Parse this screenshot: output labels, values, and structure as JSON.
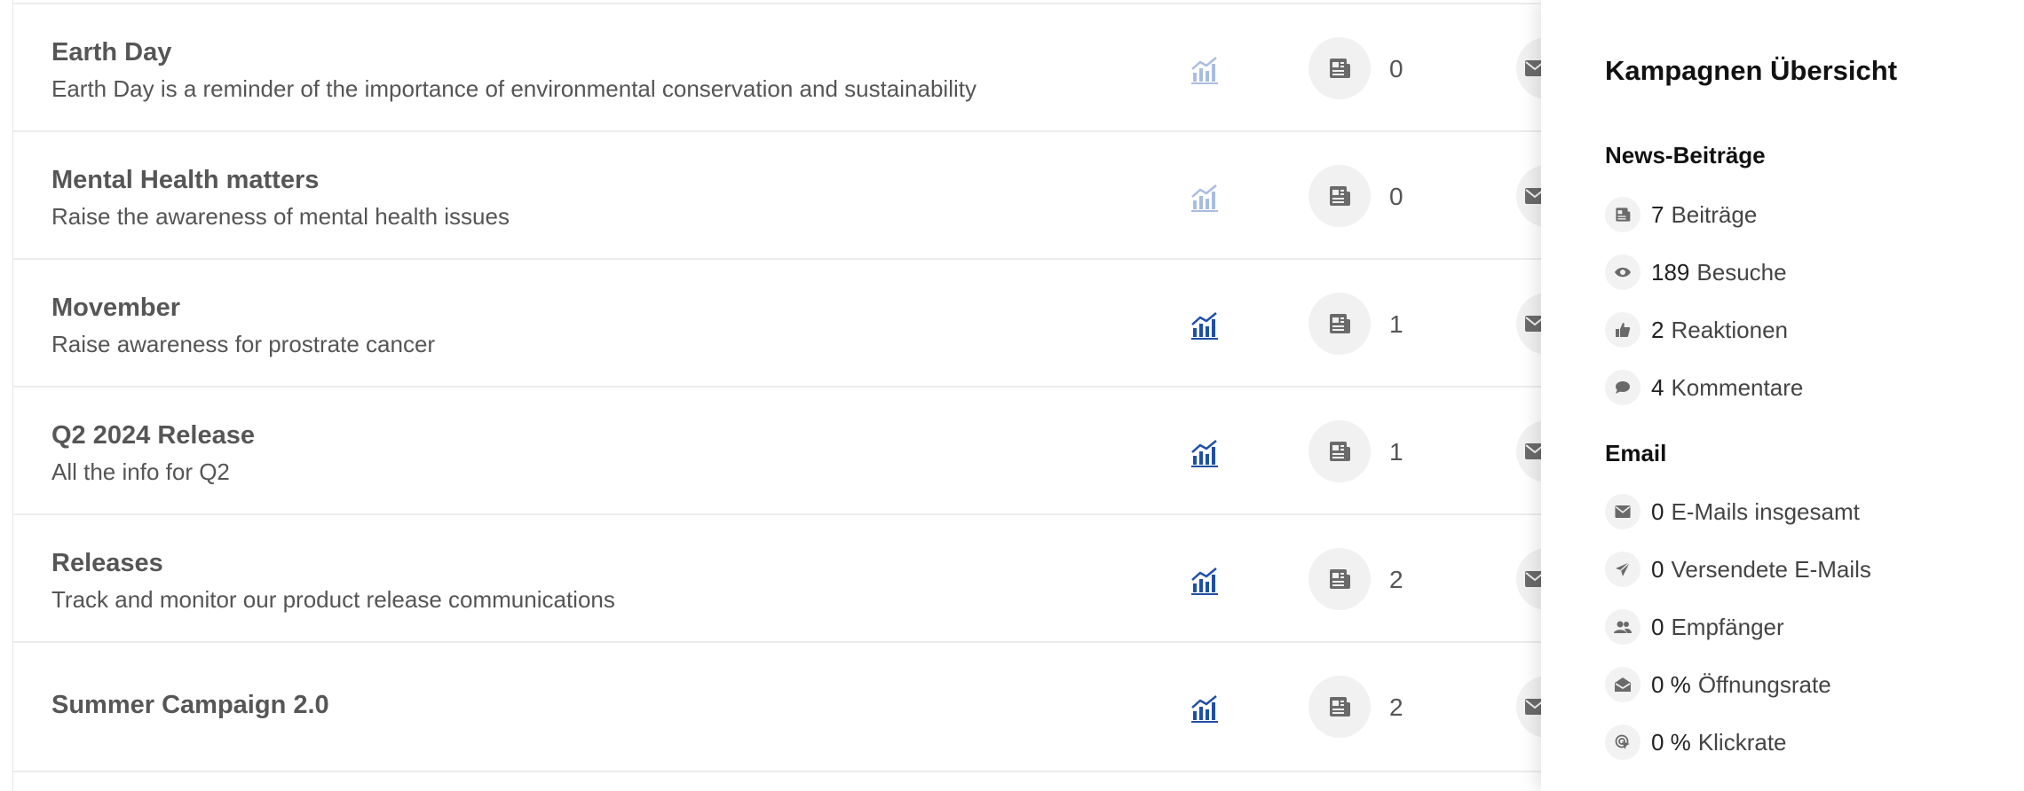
{
  "campaigns": [
    {
      "title": "Earth Day",
      "description": "Earth Day is a reminder of the importance of environmental conservation and sustainability",
      "news_count": "0",
      "stats_active": false
    },
    {
      "title": "Mental Health matters",
      "description": "Raise the awareness of mental health issues",
      "news_count": "0",
      "stats_active": false
    },
    {
      "title": "Movember",
      "description": "Raise awareness for prostrate cancer",
      "news_count": "1",
      "stats_active": true
    },
    {
      "title": "Q2 2024 Release",
      "description": "All the info for Q2",
      "news_count": "1",
      "stats_active": true
    },
    {
      "title": "Releases",
      "description": "Track and monitor our product release communications",
      "news_count": "2",
      "stats_active": true
    },
    {
      "title": "Summer Campaign 2.0",
      "description": "",
      "news_count": "2",
      "stats_active": true
    }
  ],
  "panel": {
    "title": "Kampagnen Übersicht",
    "news_section": {
      "title": "News-Beiträge",
      "stats": [
        {
          "icon": "newspaper-icon",
          "value": "7",
          "label": "Beiträge"
        },
        {
          "icon": "eye-icon",
          "value": "189",
          "label": "Besuche"
        },
        {
          "icon": "thumbs-up-icon",
          "value": "2",
          "label": "Reaktionen"
        },
        {
          "icon": "comment-icon",
          "value": "4",
          "label": "Kommentare"
        }
      ]
    },
    "email_section": {
      "title": "Email",
      "stats": [
        {
          "icon": "envelope-icon",
          "value": "0",
          "label": "E-Mails insgesamt"
        },
        {
          "icon": "paper-plane-icon",
          "value": "0",
          "label": "Versendete E-Mails"
        },
        {
          "icon": "users-icon",
          "value": "0",
          "label": "Empfänger"
        },
        {
          "icon": "envelope-open-icon",
          "value": "0 %",
          "label": "Öffnungsrate"
        },
        {
          "icon": "click-icon",
          "value": "0 %",
          "label": "Klickrate"
        }
      ]
    }
  },
  "colors": {
    "stats_active": "#1e4fa8",
    "stats_inactive": "#a9bde0"
  }
}
